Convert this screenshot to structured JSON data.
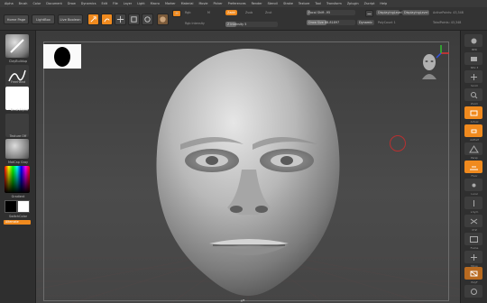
{
  "menu": [
    "Alpha",
    "Brush",
    "Color",
    "Document",
    "Draw",
    "Dynamics",
    "Edit",
    "File",
    "Layer",
    "Light",
    "Macro",
    "Marker",
    "Material",
    "Movie",
    "Picker",
    "Preferences",
    "Render",
    "Stencil",
    "Stroke",
    "Texture",
    "Tool",
    "Transform",
    "Zplugin",
    "Zscript",
    "Help"
  ],
  "toolbar": {
    "home_page": "Home Page",
    "lightbox": "LightBox",
    "live_boolean": "Live Boolean",
    "edit": "Edit",
    "draw": "Draw",
    "move": "Move",
    "scale": "Scale",
    "rotate": "Rotate",
    "mrgb": "M",
    "rgb": "Rgb",
    "m": "M",
    "zadd": "Zadd",
    "zsub": "Zsub",
    "zcut": "Zcut",
    "rgb_intensity": "Rgb Intensity",
    "z_intensity": "Z Intensity 5",
    "focal_shift": "Focal Shift -95",
    "draw_size": "Draw Size 88.81897",
    "dynamic": "Dynamic",
    "displaying": "DisplayingLevel",
    "active_points": "ActivePoints: 43,348",
    "poly_count": "PolyCount 1",
    "total_points": "TotalPoints: 43,348"
  },
  "left": {
    "brush": "ClayBuildup",
    "stroke": "FreeHand",
    "alpha": "~BrushAlpha",
    "texture": "Texture Off",
    "material": "MatCap Gray",
    "gradient": "Gradient",
    "switch_color": "SwitchColor",
    "alternate": "Alternate"
  },
  "right": [
    "BPR",
    "SPix 3",
    "Scroll",
    "Zoom",
    "Actual",
    "AAHalf",
    "Persp",
    "Floor",
    "Local",
    "L.Sym",
    "XYZ",
    "Frame",
    "Move",
    "Scale",
    "Rotate",
    "Line Fill",
    "PolyF",
    "Transp",
    "Ghost",
    "Solo",
    "Xpose"
  ],
  "colors": {
    "accent": "#f08a1e",
    "swatch_fg": "#000000",
    "swatch_bg": "#ffffff"
  }
}
